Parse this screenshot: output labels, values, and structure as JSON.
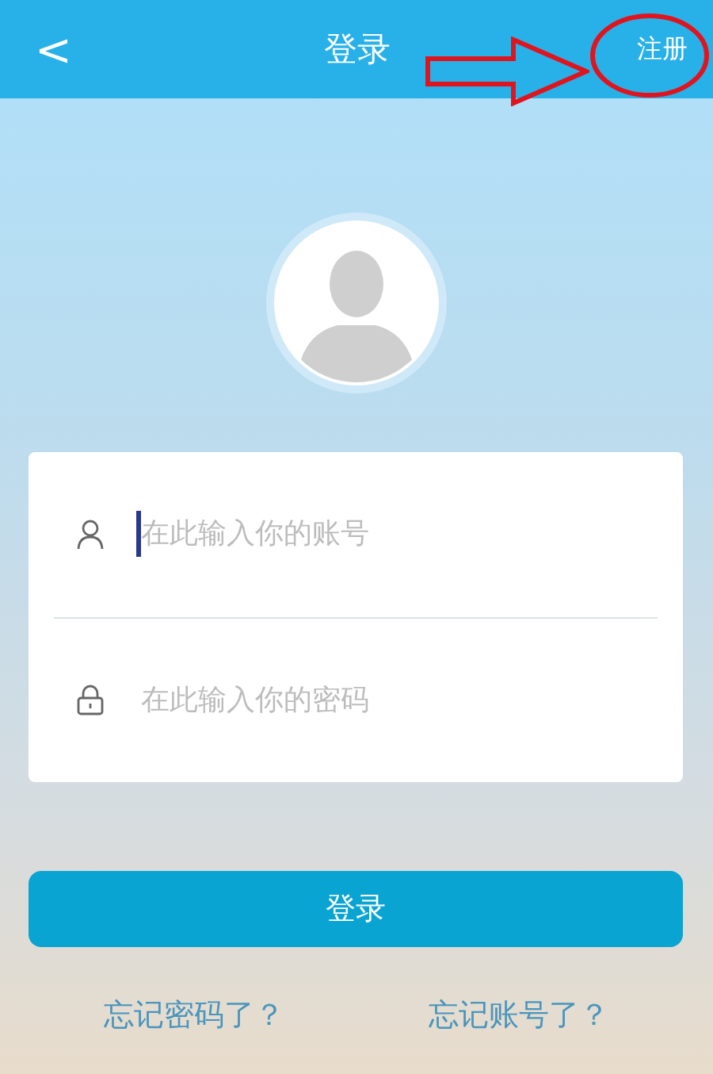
{
  "header": {
    "back": "<",
    "title": "登录",
    "action": "注册"
  },
  "fields": [
    {
      "kind": "account",
      "placeholder": "在此输入你的账号",
      "focused": true
    },
    {
      "kind": "password",
      "placeholder": "在此输入你的密码",
      "focused": false
    }
  ],
  "login_button": "登录",
  "links": [
    "忘记密码了？",
    "忘记账号了？"
  ],
  "annotations": [
    {
      "kind": "arrow"
    },
    {
      "kind": "ellipse"
    }
  ]
}
